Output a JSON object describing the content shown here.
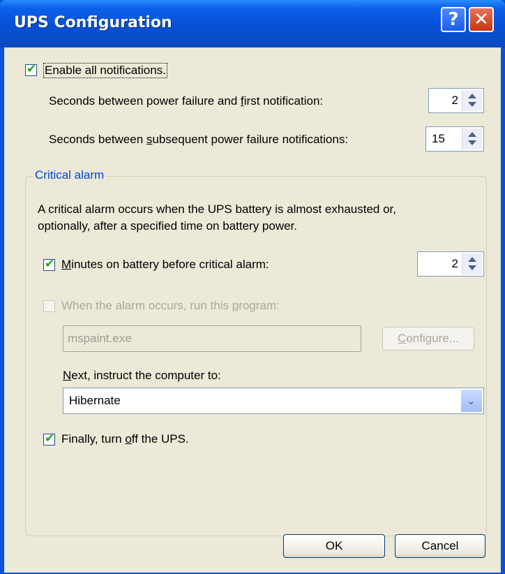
{
  "window": {
    "title": "UPS Configuration",
    "help_glyph": "?",
    "close_glyph": "✕"
  },
  "notifications": {
    "enable_all": {
      "label": "Enable all notifications.",
      "checked": true
    },
    "first_notification": {
      "label_pre": "Seconds between power failure and ",
      "label_ul": "f",
      "label_post": "irst notification:",
      "value": "2"
    },
    "subsequent_notifications": {
      "label_pre": "Seconds between ",
      "label_ul": "s",
      "label_post": "ubsequent power failure notifications:",
      "value": "15"
    }
  },
  "critical_alarm": {
    "group_label": "Critical alarm",
    "description_line1": "A critical alarm occurs when the UPS battery is almost exhausted or,",
    "description_line2": "optionally, after a specified time on battery power.",
    "minutes_on_battery": {
      "label_ul": "M",
      "label_post": "inutes on battery before critical alarm:",
      "checked": true,
      "value": "2"
    },
    "run_program": {
      "label_pre": "When the alarm occurs, run this ",
      "label_ul": "p",
      "label_post": "rogram:",
      "checked": false,
      "enabled": false,
      "program_value": "mspaint.exe",
      "configure_ul": "C",
      "configure_post": "onfigure..."
    },
    "next_instruct": {
      "label_ul": "N",
      "label_post": "ext, instruct the computer to:",
      "selected": "Hibernate"
    },
    "turn_off_ups": {
      "label_pre": "Finally, turn ",
      "label_ul": "o",
      "label_post": "ff the UPS.",
      "checked": true
    }
  },
  "buttons": {
    "ok": "OK",
    "cancel": "Cancel"
  },
  "colors": {
    "titlebar": "#0650d6",
    "check": "#21a121",
    "group_label": "#0046d5"
  },
  "icons": {
    "help": "help-icon",
    "close": "close-icon",
    "spinner": "spin-arrows-icon",
    "dropdown": "chevron-down-icon"
  }
}
